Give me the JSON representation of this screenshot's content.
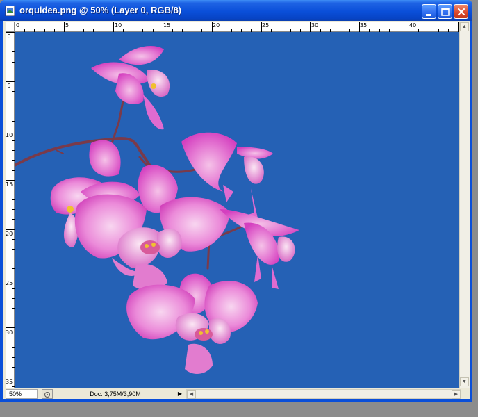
{
  "window": {
    "title": "orquidea.png @ 50% (Layer 0, RGB/8)"
  },
  "rulers": {
    "horizontal": [
      "0",
      "5",
      "10",
      "15",
      "20",
      "25",
      "30",
      "35",
      "40"
    ],
    "vertical": [
      "0",
      "5",
      "10",
      "15",
      "20",
      "25",
      "30",
      "35"
    ]
  },
  "canvas": {
    "background_color": "#2561b5",
    "image": "pink orchid branch"
  },
  "status": {
    "zoom": "50%",
    "doc_info": "Doc: 3,75M/3,90M"
  },
  "icons": {
    "app": "photoshop-doc-icon",
    "minimize": "minimize-icon",
    "maximize": "maximize-icon",
    "close": "close-icon"
  }
}
